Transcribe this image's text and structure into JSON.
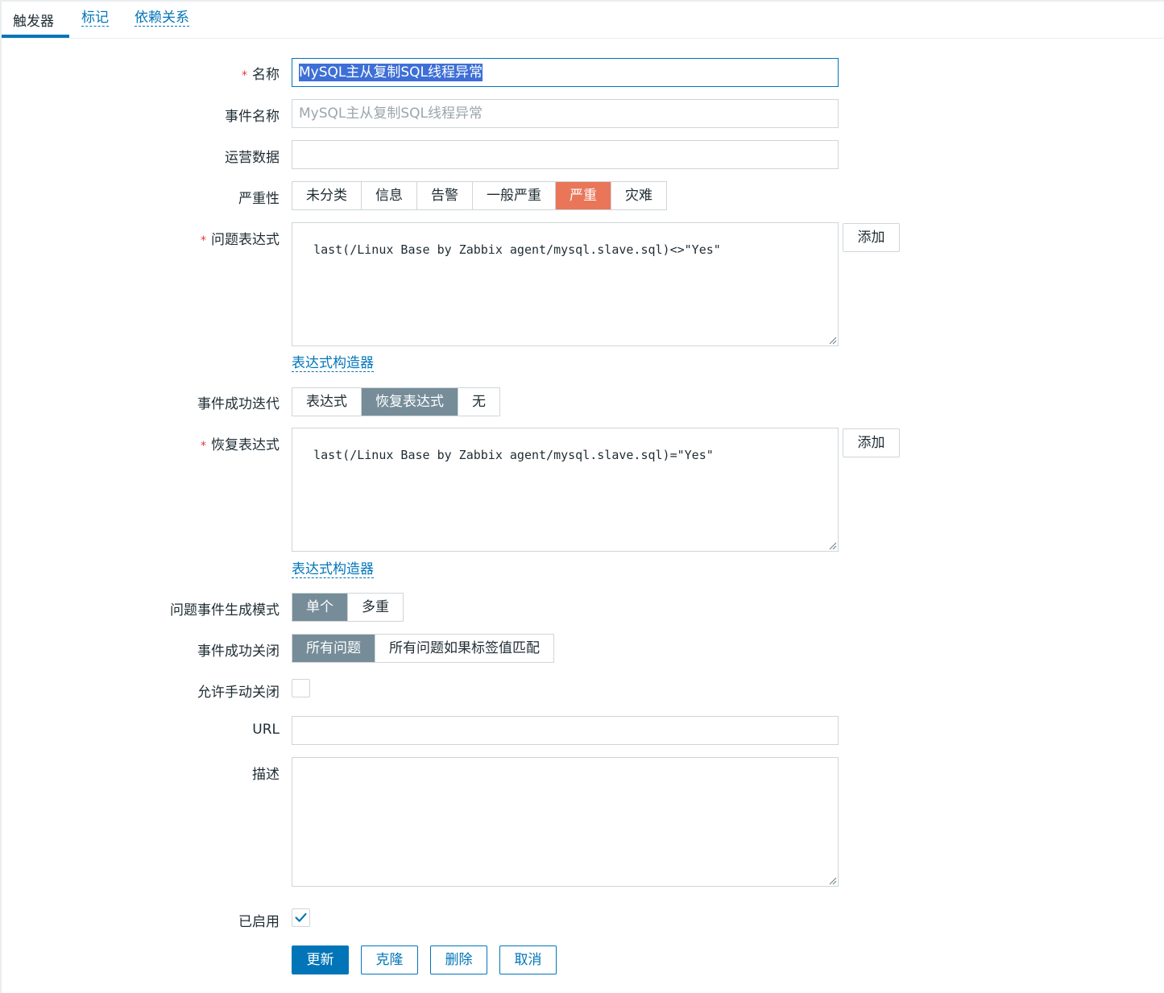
{
  "tabs": [
    {
      "label": "触发器"
    },
    {
      "label": "标记"
    },
    {
      "label": "依赖关系"
    }
  ],
  "form": {
    "required_mark": "*",
    "name": {
      "label": "名称",
      "value": "MySQL主从复制SQL线程异常"
    },
    "event_name": {
      "label": "事件名称",
      "placeholder": "MySQL主从复制SQL线程异常"
    },
    "opdata": {
      "label": "运营数据",
      "value": ""
    },
    "severity": {
      "label": "严重性",
      "options": [
        "未分类",
        "信息",
        "告警",
        "一般严重",
        "严重",
        "灾难"
      ],
      "selected": "严重"
    },
    "problem_expression": {
      "label": "问题表达式",
      "value": "last(/Linux Base by Zabbix agent/mysql.slave.sql)<>\"Yes\"",
      "add_label": "添加",
      "builder_link": "表达式构造器"
    },
    "ok_event_generation": {
      "label": "事件成功迭代",
      "options": [
        "表达式",
        "恢复表达式",
        "无"
      ],
      "selected": "恢复表达式"
    },
    "recovery_expression": {
      "label": "恢复表达式",
      "value": "last(/Linux Base by Zabbix agent/mysql.slave.sql)=\"Yes\"",
      "add_label": "添加",
      "builder_link": "表达式构造器"
    },
    "problem_mode": {
      "label": "问题事件生成模式",
      "options": [
        "单个",
        "多重"
      ],
      "selected": "单个"
    },
    "ok_event_close": {
      "label": "事件成功关闭",
      "options": [
        "所有问题",
        "所有问题如果标签值匹配"
      ],
      "selected": "所有问题"
    },
    "manual_close": {
      "label": "允许手动关闭",
      "checked": false
    },
    "url": {
      "label": "URL",
      "value": ""
    },
    "description": {
      "label": "描述",
      "value": ""
    },
    "enabled": {
      "label": "已启用",
      "checked": true
    }
  },
  "buttons": {
    "update": "更新",
    "clone": "克隆",
    "delete": "删除",
    "cancel": "取消"
  },
  "colors": {
    "accent": "#0275b8",
    "severity_high": "#e97659",
    "segment_selected": "#768d99",
    "required": "#e33734"
  }
}
